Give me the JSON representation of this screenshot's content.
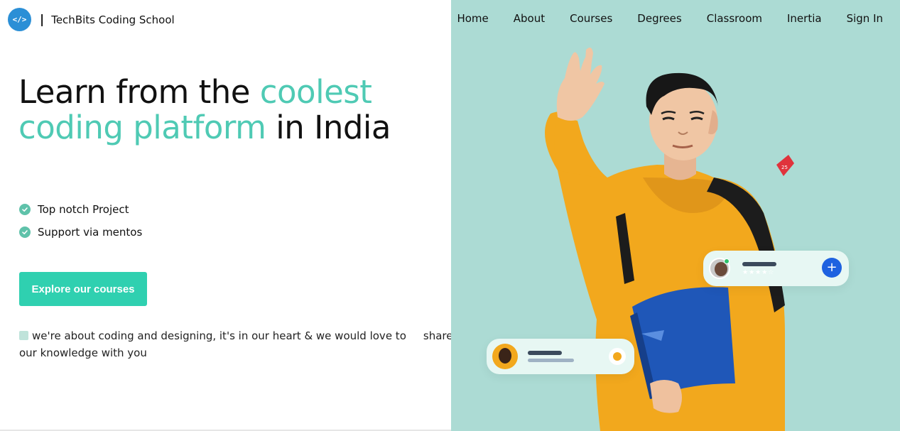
{
  "brand": {
    "logo_text": "</>",
    "separator": "|",
    "name": "TechBits Coding School"
  },
  "nav": {
    "items": [
      "Home",
      "About",
      "Courses",
      "Degrees",
      "Classroom",
      "Inertia",
      "Sign In"
    ]
  },
  "hero": {
    "title_part1": "Learn from the ",
    "title_accent": "coolest coding platform",
    "title_part2": " in India",
    "features": [
      "Top notch Project",
      "Support via mentos"
    ],
    "cta_label": "Explore our courses",
    "tagline_part1": "we're about coding and designing, it's in our heart & we would love to",
    "tagline_part2": "share our knowledge with you"
  },
  "illustration": {
    "badge_text": "25",
    "icons": [
      "hand-wave",
      "backpack",
      "book",
      "avatar",
      "plus-icon",
      "chat-bubble-icon",
      "heart-icon"
    ]
  },
  "colors": {
    "accent": "#4fcab4",
    "cta": "#2fd0b0",
    "right_panel": "#acdbd4",
    "hoodie": "#f2a81d",
    "book": "#1f57b8"
  }
}
